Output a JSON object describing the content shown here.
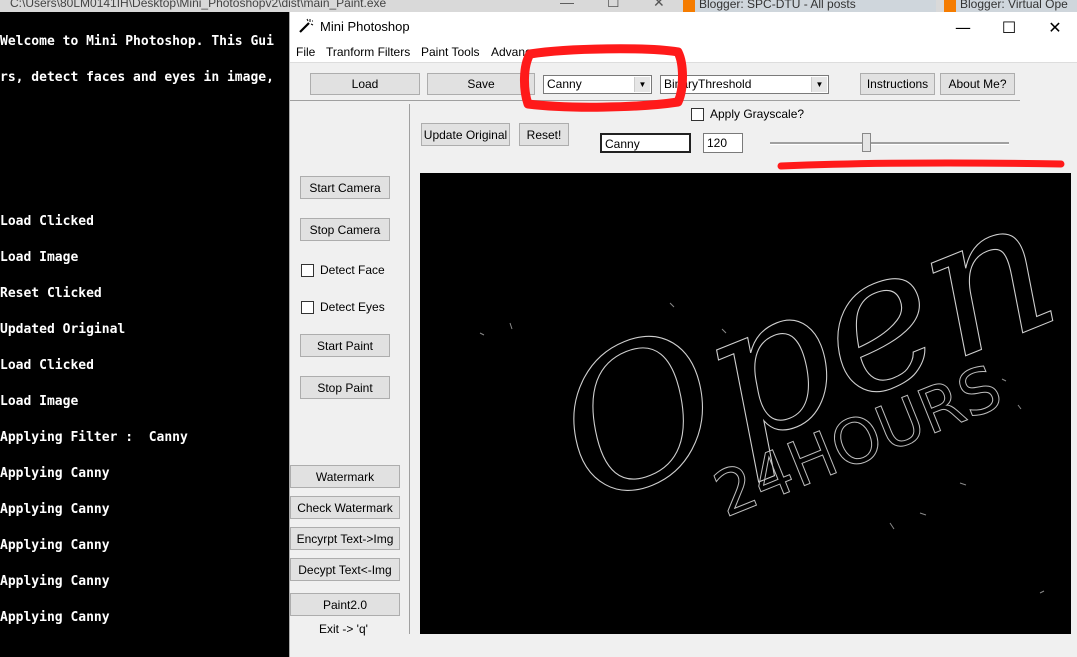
{
  "background": {
    "console_window_title": "C:\\Users\\80LM0141IH\\Desktop\\Mini_Photoshopv2\\dist\\main_Paint.exe",
    "browser_tabs": [
      "Blogger: SPC-DTU - All posts",
      "Blogger: Virtual Ope"
    ]
  },
  "console": {
    "lines": [
      "Welcome to Mini Photoshop. This Gui",
      "rs, detect faces and eyes in image,",
      "",
      "",
      "",
      "Load Clicked",
      "Load Image",
      "Reset Clicked",
      "Updated Original",
      "Load Clicked",
      "Load Image",
      "Applying Filter :  Canny",
      "Applying Canny",
      "Applying Canny",
      "Applying Canny",
      "Applying Canny",
      "Applying Canny"
    ]
  },
  "window": {
    "title": "Mini Photoshop",
    "icon": "wand-icon",
    "controls": {
      "minimize": "—",
      "maximize": "☐",
      "close": "✕"
    }
  },
  "menu": [
    "File",
    "Tranform Filters",
    "Paint Tools",
    "Advanc"
  ],
  "toolbar": {
    "load": "Load",
    "save": "Save",
    "filter_select": "Canny",
    "threshold_select": "BinaryThreshold",
    "instructions": "Instructions",
    "about": "About Me?"
  },
  "controls": {
    "apply_grayscale": "Apply Grayscale?",
    "update_original": "Update Original",
    "reset": "Reset!",
    "filter_name": "Canny",
    "value": "120"
  },
  "sidebar": {
    "start_camera": "Start Camera",
    "stop_camera": "Stop Camera",
    "detect_face": "Detect Face",
    "detect_eyes": "Detect Eyes",
    "start_paint": "Start Paint",
    "stop_paint": "Stop Paint",
    "watermark": "Watermark",
    "check_watermark": "Check Watermark",
    "encrypt": "Encyrpt Text->Img",
    "decrypt": "Decypt Text<-Img",
    "paint2": "Paint2.0",
    "exit": "Exit -> 'q'"
  },
  "image": {
    "sign_word": "Open",
    "sign_sub": "24HOURS"
  },
  "colors": {
    "annotation_red": "#ff1a1a",
    "window_bg": "#f0f0f0",
    "canvas_bg": "#000000",
    "edge_stroke": "#d0d0d0"
  }
}
